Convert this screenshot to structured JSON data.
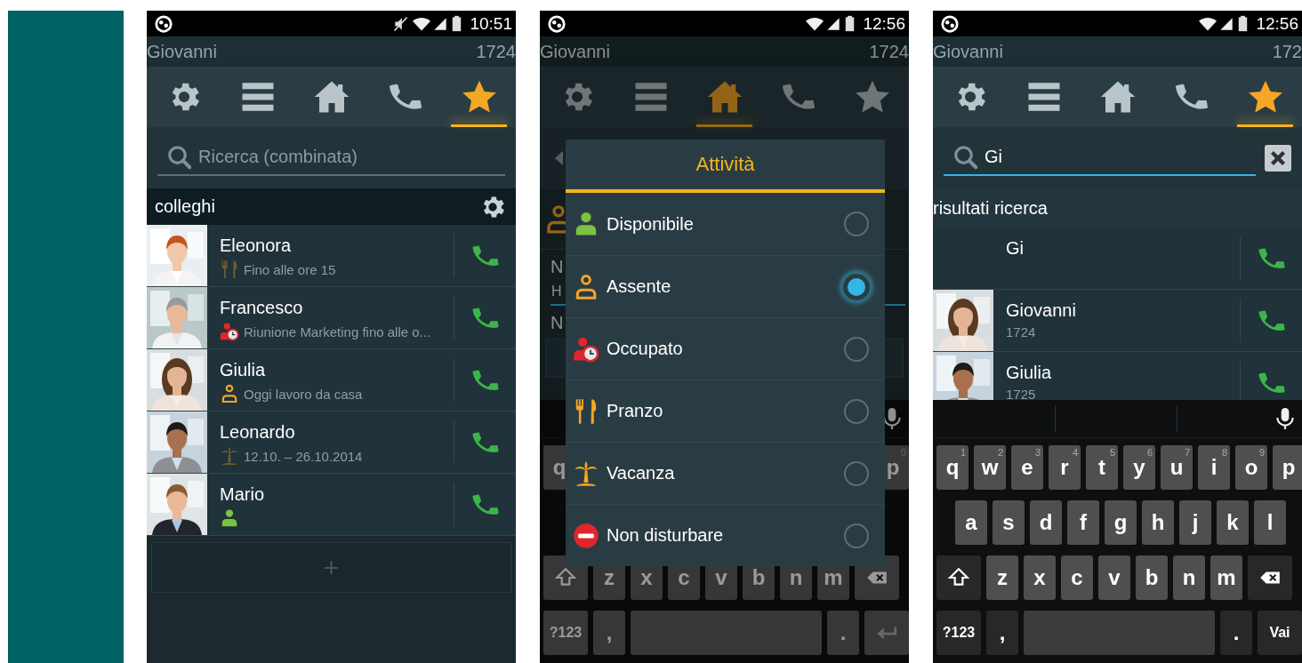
{
  "phones": [
    {
      "status_bar": {
        "time": "10:51",
        "muted": true
      },
      "header": {
        "user": "Giovanni",
        "extension": "1724"
      },
      "tabs": [
        {
          "selected": false
        },
        {
          "selected": false
        },
        {
          "selected": false
        },
        {
          "selected": false
        },
        {
          "selected": true
        }
      ],
      "search": {
        "placeholder": "Ricerca (combinata)"
      },
      "section": {
        "title": "colleghi",
        "settings": true
      },
      "contacts": [
        {
          "name": "Eleonora",
          "kind": "lunch",
          "note": "Fino alle ore 15",
          "photo": true
        },
        {
          "name": "Francesco",
          "kind": "busy",
          "note": "Riunione Marketing fino alle o...",
          "photo": true
        },
        {
          "name": "Giulia",
          "kind": "away",
          "note": "Oggi lavoro da casa",
          "photo": true
        },
        {
          "name": "Leonardo",
          "kind": "vacation",
          "note": "12.10. – 26.10.2014",
          "photo": true
        },
        {
          "name": "Mario",
          "kind": "available",
          "photo": true
        }
      ],
      "add_button": {
        "label": "+"
      }
    },
    {
      "status_bar": {
        "time": "12:56"
      },
      "header": {
        "user": "Giovanni",
        "extension": "1724"
      },
      "tabs": [
        {
          "selected": false
        },
        {
          "selected": false
        },
        {
          "selected": true
        },
        {
          "selected": false
        },
        {
          "selected": false
        }
      ],
      "form": {
        "label_1": "N",
        "field_value": "H",
        "label_2": "N"
      },
      "keyboard": {
        "top_row": [
          {
            "label": "q"
          },
          {
            "label": "p",
            "hint": "0"
          }
        ],
        "shift_row": [
          "z",
          "x",
          "c",
          "v",
          "b",
          "n",
          "m"
        ],
        "bottom_row": {
          "symbols": "?123",
          "comma": ",",
          "period": "."
        }
      },
      "dialog": {
        "title": "Attività",
        "options": [
          {
            "label": "Disponibile",
            "kind": "available",
            "selected": false
          },
          {
            "label": "Assente",
            "kind": "away",
            "selected": true
          },
          {
            "label": "Occupato",
            "kind": "busy",
            "selected": false
          },
          {
            "label": "Pranzo",
            "kind": "lunch",
            "selected": false
          },
          {
            "label": "Vacanza",
            "kind": "vacation",
            "selected": false
          },
          {
            "label": "Non disturbare",
            "kind": "dnd",
            "selected": false
          }
        ]
      }
    },
    {
      "status_bar": {
        "time": "12:56"
      },
      "header": {
        "user": "Giovanni",
        "extension": "172"
      },
      "tabs": [
        {
          "selected": false
        },
        {
          "selected": false
        },
        {
          "selected": false
        },
        {
          "selected": false
        },
        {
          "selected": true
        }
      ],
      "search": {
        "value": "Gi"
      },
      "section": {
        "title": "risultati ricerca"
      },
      "contacts": [
        {
          "name": "Gi",
          "photo": false
        },
        {
          "name": "Giovanni",
          "note": "1724",
          "photo": true
        },
        {
          "name": "Giulia",
          "note": "1725",
          "photo": true
        }
      ],
      "keyboard": {
        "top_row": [
          {
            "label": "q",
            "hint": "1"
          },
          {
            "label": "w",
            "hint": "2"
          },
          {
            "label": "e",
            "hint": "3"
          },
          {
            "label": "r",
            "hint": "4"
          },
          {
            "label": "t",
            "hint": "5"
          },
          {
            "label": "y",
            "hint": "6"
          },
          {
            "label": "u",
            "hint": "7"
          },
          {
            "label": "i",
            "hint": "8"
          },
          {
            "label": "o",
            "hint": "9"
          },
          {
            "label": "p"
          }
        ],
        "middle_row": [
          "a",
          "s",
          "d",
          "f",
          "g",
          "h",
          "j",
          "k",
          "l"
        ],
        "shift_row": [
          "z",
          "x",
          "c",
          "v",
          "b",
          "n",
          "m"
        ],
        "bottom_row": {
          "symbols": "?123",
          "comma": ",",
          "period": ".",
          "action": "Vai"
        }
      }
    }
  ]
}
